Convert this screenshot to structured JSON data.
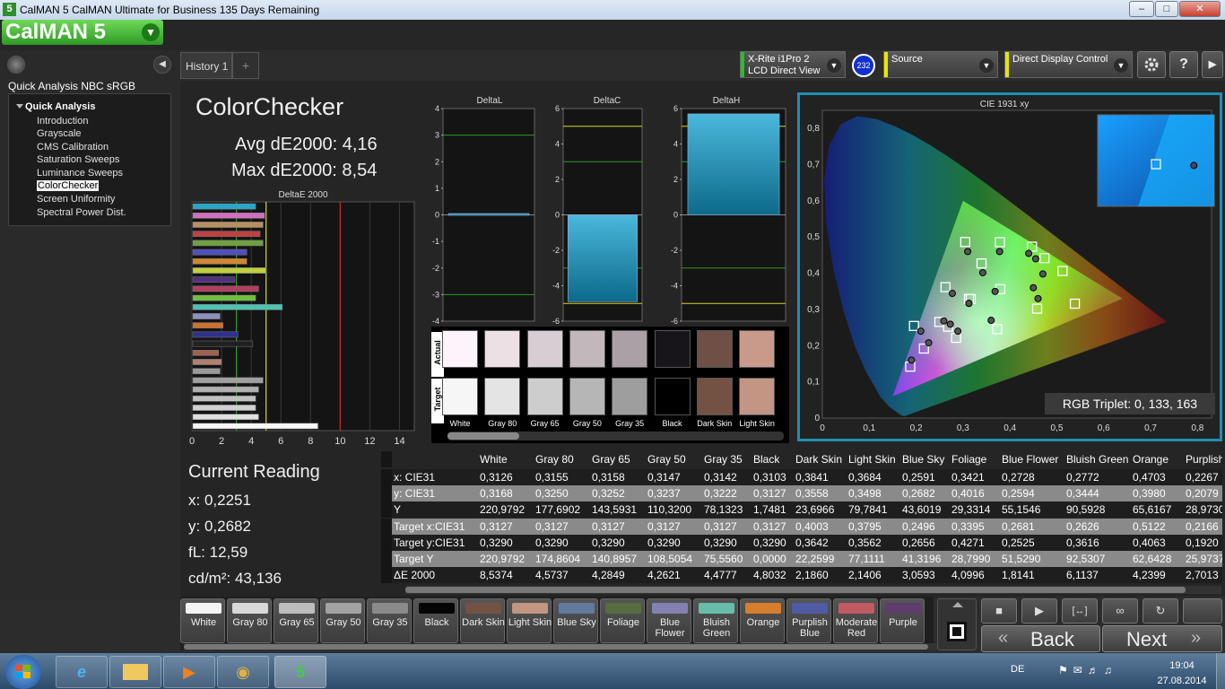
{
  "window": {
    "title": "CalMAN 5 CalMAN Ultimate for Business 135 Days Remaining",
    "icon_label": "5",
    "btn_min": "–",
    "btn_max": "□",
    "btn_close": "✕"
  },
  "logo": {
    "text": "CalMAN 5",
    "drop": "▼"
  },
  "sidebar": {
    "title": "Quick Analysis NBC sRGB",
    "root": "Quick Analysis",
    "collapse_icon": "◀",
    "items": [
      {
        "label": "Introduction"
      },
      {
        "label": "Grayscale"
      },
      {
        "label": "CMS Calibration"
      },
      {
        "label": "Saturation Sweeps"
      },
      {
        "label": "Luminance Sweeps"
      },
      {
        "label": "ColorChecker",
        "selected": true
      },
      {
        "label": "Screen Uniformity"
      },
      {
        "label": "Spectral Power Dist."
      }
    ]
  },
  "tabs": {
    "history": "History 1",
    "add": "+"
  },
  "devices": {
    "meter_line1": "X-Rite i1Pro 2",
    "meter_line2": "LCD Direct View",
    "meter_badge": "232",
    "source": "Source",
    "display": "Direct Display Control",
    "dd": "▼",
    "accent_meter": "#22c422",
    "accent_source": "#e6e600",
    "accent_display": "#e6e600"
  },
  "toolbar": {
    "settings_icon": "gear-icon",
    "help": "?",
    "collapse": "▶"
  },
  "summary": {
    "title": "ColorChecker",
    "avg": "Avg dE2000: 4,16",
    "max": "Max dE2000: 8,54"
  },
  "chart_data": [
    {
      "type": "bar",
      "title": "DeltaE 2000",
      "orientation": "horizontal",
      "x_ticks": [
        "0",
        "2",
        "4",
        "6",
        "8",
        "10",
        "12",
        "14"
      ],
      "xlim": [
        0,
        15
      ],
      "values": [
        4.3,
        4.9,
        4.8,
        4.6,
        4.8,
        3.7,
        3.7,
        5.0,
        2.9,
        4.5,
        4.3,
        6.1,
        1.9,
        2.1,
        3.1,
        4.1,
        1.8,
        2.0,
        1.9,
        4.8,
        4.5,
        4.3,
        4.3,
        4.5,
        8.5
      ],
      "colors": [
        "#2aa6c8",
        "#d070c0",
        "#b89060",
        "#c04040",
        "#70a040",
        "#5050c0",
        "#d08830",
        "#c0d040",
        "#503080",
        "#b04060",
        "#70c040",
        "#50c0b0",
        "#9090c0",
        "#d07030",
        "#303090",
        "#202020",
        "#a06050",
        "#b08070",
        "#9a9a9a",
        "#a0a0a0",
        "#b0b0b0",
        "#c0c0c0",
        "#d0d0d0",
        "#e0e0e0",
        "#f8f8f8"
      ],
      "reference_lines": [
        {
          "value": 3,
          "color": "#2e9a2e"
        },
        {
          "value": 5,
          "color": "#d8d820"
        },
        {
          "value": 10,
          "color": "#c82828"
        }
      ]
    },
    {
      "type": "bar",
      "title": "DeltaL",
      "ylim": [
        -4,
        4
      ],
      "y_ticks": [
        "4",
        "3",
        "2",
        "1",
        "0",
        "-1",
        "-2",
        "-3",
        "-4"
      ],
      "values": [
        0.05
      ]
    },
    {
      "type": "bar",
      "title": "DeltaC",
      "ylim": [
        -6,
        6
      ],
      "y_ticks": [
        "6",
        "4",
        "2",
        "0",
        "-2",
        "-4",
        "-6"
      ],
      "values": [
        -4.9
      ]
    },
    {
      "type": "bar",
      "title": "DeltaH",
      "ylim": [
        -6,
        6
      ],
      "y_ticks": [
        "6",
        "4",
        "2",
        "0",
        "-2",
        "-4",
        "-6"
      ],
      "values": [
        5.7
      ]
    },
    {
      "type": "scatter",
      "title": "CIE 1931 xy",
      "x_ticks": [
        "0",
        "0,1",
        "0,2",
        "0,3",
        "0,4",
        "0,5",
        "0,6",
        "0,7",
        "0,8"
      ],
      "y_ticks": [
        "0,8",
        "0,7",
        "0,6",
        "0,5",
        "0,4",
        "0,3",
        "0,2",
        "0,1",
        "0"
      ],
      "xlim": [
        0,
        0.83
      ],
      "ylim": [
        0,
        0.85
      ],
      "gamut": [
        [
          0.64,
          0.33
        ],
        [
          0.3,
          0.6
        ],
        [
          0.15,
          0.06
        ]
      ],
      "white_point": [
        0.3127,
        0.329
      ],
      "targets": [
        [
          0.3127,
          0.329
        ],
        [
          0.3795,
          0.3562
        ],
        [
          0.2496,
          0.2656
        ],
        [
          0.3395,
          0.4271
        ],
        [
          0.2681,
          0.2525
        ],
        [
          0.2626,
          0.3616
        ],
        [
          0.5122,
          0.4063
        ],
        [
          0.2166,
          0.192
        ],
        [
          0.458,
          0.3022
        ],
        [
          0.2853,
          0.2216
        ],
        [
          0.3787,
          0.4859
        ],
        [
          0.4737,
          0.4419
        ],
        [
          0.1874,
          0.142
        ],
        [
          0.3047,
          0.4863
        ],
        [
          0.5385,
          0.316
        ],
        [
          0.4471,
          0.4734
        ],
        [
          0.3728,
          0.2458
        ],
        [
          0.1954,
          0.2545
        ],
        [
          0.3166,
          0.3288
        ]
      ],
      "actual": [
        [
          0.3126,
          0.3168
        ],
        [
          0.3684,
          0.3498
        ],
        [
          0.2591,
          0.2682
        ],
        [
          0.3421,
          0.4016
        ],
        [
          0.2728,
          0.2594
        ],
        [
          0.2772,
          0.3444
        ],
        [
          0.4703,
          0.398
        ],
        [
          0.2267,
          0.2079
        ],
        [
          0.46,
          0.33
        ],
        [
          0.289,
          0.24
        ],
        [
          0.378,
          0.46
        ],
        [
          0.455,
          0.44
        ],
        [
          0.19,
          0.16
        ],
        [
          0.31,
          0.46
        ],
        [
          0.45,
          0.36
        ],
        [
          0.44,
          0.455
        ],
        [
          0.36,
          0.27
        ],
        [
          0.21,
          0.24
        ],
        [
          0.3126,
          0.3168
        ]
      ],
      "inset_target": [
        0.3127,
        0.329
      ],
      "inset_actual": [
        0.3126,
        0.3168
      ]
    }
  ],
  "cie_readout": "RGB Triplet: 0, 133, 163",
  "swatches": {
    "actual_label": "Actual",
    "target_label": "Target",
    "items": [
      {
        "name": "White",
        "actual": "#fdf3fb",
        "target": "#f6f6f6"
      },
      {
        "name": "Gray 80",
        "actual": "#ece0e5",
        "target": "#e4e4e4"
      },
      {
        "name": "Gray 65",
        "actual": "#d8cdd2",
        "target": "#cdcdcd"
      },
      {
        "name": "Gray 50",
        "actual": "#c2b8bc",
        "target": "#b6b6b6"
      },
      {
        "name": "Gray 35",
        "actual": "#aaa0a6",
        "target": "#9e9e9e"
      },
      {
        "name": "Black",
        "actual": "#17151a",
        "target": "#000000"
      },
      {
        "name": "Dark Skin",
        "actual": "#6e5047",
        "target": "#735244"
      },
      {
        "name": "Light Skin",
        "actual": "#c99a8a",
        "target": "#c29682"
      }
    ]
  },
  "table": {
    "columns": [
      "",
      "White",
      "Gray 80",
      "Gray 65",
      "Gray 50",
      "Gray 35",
      "Black",
      "Dark Skin",
      "Light Skin",
      "Blue Sky",
      "Foliage",
      "Blue Flower",
      "Bluish Green",
      "Orange",
      "Purplish"
    ],
    "rows": [
      {
        "label": "x: CIE31",
        "values": [
          "0,3126",
          "0,3155",
          "0,3158",
          "0,3147",
          "0,3142",
          "0,3103",
          "0,3841",
          "0,3684",
          "0,2591",
          "0,3421",
          "0,2728",
          "0,2772",
          "0,4703",
          "0,2267"
        ]
      },
      {
        "label": "y: CIE31",
        "values": [
          "0,3168",
          "0,3250",
          "0,3252",
          "0,3237",
          "0,3222",
          "0,3127",
          "0,3558",
          "0,3498",
          "0,2682",
          "0,4016",
          "0,2594",
          "0,3444",
          "0,3980",
          "0,2079"
        ]
      },
      {
        "label": "Y",
        "values": [
          "220,9792",
          "177,6902",
          "143,5931",
          "110,3200",
          "78,1323",
          "1,7481",
          "23,6966",
          "79,7841",
          "43,6019",
          "29,3314",
          "55,1546",
          "90,5928",
          "65,6167",
          "28,9730"
        ]
      },
      {
        "label": "Target x:CIE31",
        "values": [
          "0,3127",
          "0,3127",
          "0,3127",
          "0,3127",
          "0,3127",
          "0,3127",
          "0,4003",
          "0,3795",
          "0,2496",
          "0,3395",
          "0,2681",
          "0,2626",
          "0,5122",
          "0,2166"
        ]
      },
      {
        "label": "Target y:CIE31",
        "values": [
          "0,3290",
          "0,3290",
          "0,3290",
          "0,3290",
          "0,3290",
          "0,3290",
          "0,3642",
          "0,3562",
          "0,2656",
          "0,4271",
          "0,2525",
          "0,3616",
          "0,4063",
          "0,1920"
        ]
      },
      {
        "label": "Target Y",
        "values": [
          "220,9792",
          "174,8604",
          "140,8957",
          "108,5054",
          "75,5560",
          "0,0000",
          "22,2599",
          "77,1111",
          "41,3196",
          "28,7990",
          "51,5290",
          "92,5307",
          "62,6428",
          "25,9737"
        ]
      },
      {
        "label": "ΔE 2000",
        "values": [
          "8,5374",
          "4,5737",
          "4,2849",
          "4,2621",
          "4,4777",
          "4,8032",
          "2,1860",
          "2,1406",
          "3,0593",
          "4,0996",
          "1,8141",
          "6,1137",
          "4,2399",
          "2,7013"
        ]
      }
    ]
  },
  "reading": {
    "title": "Current Reading",
    "x": "x: 0,2251",
    "y": "y: 0,2682",
    "fl": "fL: 12,59",
    "cd": "cd/m²: 43,136"
  },
  "patches": [
    {
      "name": "White",
      "color": "#f4f4f4"
    },
    {
      "name": "Gray 80",
      "color": "#d8d8d8"
    },
    {
      "name": "Gray 65",
      "color": "#bdbdbd"
    },
    {
      "name": "Gray 50",
      "color": "#a2a2a2"
    },
    {
      "name": "Gray 35",
      "color": "#8a8a8a"
    },
    {
      "name": "Black",
      "color": "#050505"
    },
    {
      "name": "Dark Skin",
      "color": "#735244"
    },
    {
      "name": "Light Skin",
      "color": "#c29682"
    },
    {
      "name": "Blue Sky",
      "color": "#627a9d"
    },
    {
      "name": "Foliage",
      "color": "#576c43"
    },
    {
      "name": "Blue Flower",
      "color": "#8580b1"
    },
    {
      "name": "Bluish Green",
      "color": "#67bdaa"
    },
    {
      "name": "Orange",
      "color": "#d67e2c"
    },
    {
      "name": "Purplish Blue",
      "color": "#505ba6"
    },
    {
      "name": "Moderate Red",
      "color": "#c15a63"
    },
    {
      "name": "Purple",
      "color": "#5e3c6c"
    }
  ],
  "controls": {
    "stop": "■",
    "play": "▶",
    "frame": "[↔]",
    "loop": "∞",
    "refresh": "↻",
    "back": "Back",
    "next": "Next",
    "back_icon": "«",
    "next_icon": "»"
  },
  "taskbar": {
    "start_icon": "windows-start-icon",
    "apps": [
      "internet-explorer-icon",
      "file-explorer-icon",
      "media-player-icon",
      "paint-icon",
      "calman-icon"
    ],
    "lang": "DE",
    "time": "19:04",
    "date": "27.08.2014"
  }
}
